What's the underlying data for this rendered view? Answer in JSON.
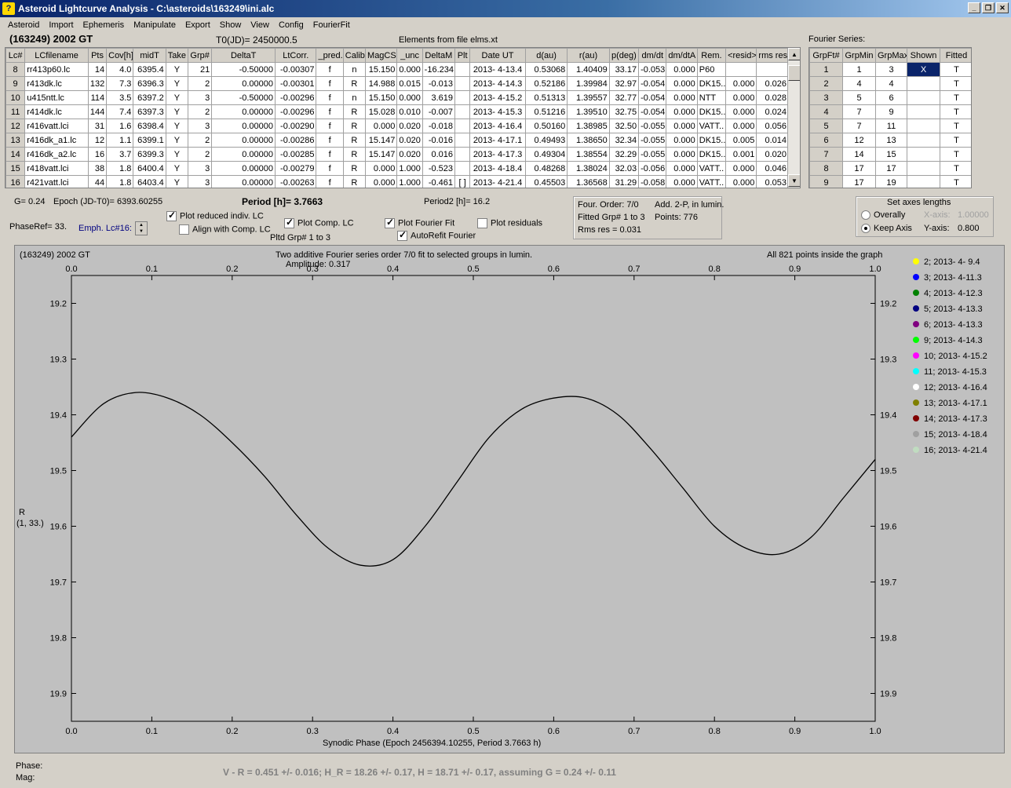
{
  "window": {
    "title": "Asteroid Lightcurve Analysis - C:\\asteroids\\163249\\ini.alc",
    "app_icon_label": "?"
  },
  "menu": [
    "Asteroid",
    "Import",
    "Ephemeris",
    "Manipulate",
    "Export",
    "Show",
    "View",
    "Config",
    "FourierFit"
  ],
  "header": {
    "asteroid": "(163249) 2002 GT",
    "t0": "T0(JD)= 2450000.5",
    "elements": "Elements from file elms.xt"
  },
  "lc_table": {
    "columns": [
      "Lc#",
      "LCfilename",
      "Pts",
      "Cov[h]",
      "midT",
      "Take",
      "Grp#",
      "DeltaT",
      "LtCorr.",
      "_pred.",
      "Calib.",
      "MagCS",
      "_unc",
      "DeltaM",
      "Plt",
      "Date UT",
      "d(au)",
      "r(au)",
      "p(deg)",
      "dm/dt",
      "dm/dtA",
      "Rem.",
      "<resid>",
      "rms res"
    ],
    "rows": [
      [
        "8",
        "rr413p60.lc",
        "14",
        "4.0",
        "6395.4",
        "Y",
        "21",
        "-0.50000",
        "-0.00307",
        "f",
        "n",
        "15.150",
        "0.000",
        "-16.234",
        "",
        "2013- 4-13.4",
        "0.53068",
        "1.40409",
        "33.17",
        "-0.053",
        "0.000",
        "P60",
        "",
        ""
      ],
      [
        "9",
        "r413dk.lc",
        "132",
        "7.3",
        "6396.3",
        "Y",
        "2",
        "0.00000",
        "-0.00301",
        "f",
        "R",
        "14.988",
        "0.015",
        "-0.013",
        "",
        "2013- 4-14.3",
        "0.52186",
        "1.39984",
        "32.97",
        "-0.054",
        "0.000",
        "DK15..",
        "0.000",
        "0.026"
      ],
      [
        "10",
        "u415ntt.lc",
        "114",
        "3.5",
        "6397.2",
        "Y",
        "3",
        "-0.50000",
        "-0.00296",
        "f",
        "n",
        "15.150",
        "0.000",
        "3.619",
        "",
        "2013- 4-15.2",
        "0.51313",
        "1.39557",
        "32.77",
        "-0.054",
        "0.000",
        "NTT",
        "0.000",
        "0.028"
      ],
      [
        "11",
        "r414dk.lc",
        "144",
        "7.4",
        "6397.3",
        "Y",
        "2",
        "0.00000",
        "-0.00296",
        "f",
        "R",
        "15.028",
        "0.010",
        "-0.007",
        "",
        "2013- 4-15.3",
        "0.51216",
        "1.39510",
        "32.75",
        "-0.054",
        "0.000",
        "DK15..",
        "0.000",
        "0.024"
      ],
      [
        "12",
        "r416vatt.lci",
        "31",
        "1.6",
        "6398.4",
        "Y",
        "3",
        "0.00000",
        "-0.00290",
        "f",
        "R",
        "0.000",
        "0.020",
        "-0.018",
        "",
        "2013- 4-16.4",
        "0.50160",
        "1.38985",
        "32.50",
        "-0.055",
        "0.000",
        "VATT..",
        "0.000",
        "0.056"
      ],
      [
        "13",
        "r416dk_a1.lc",
        "12",
        "1.1",
        "6399.1",
        "Y",
        "2",
        "0.00000",
        "-0.00286",
        "f",
        "R",
        "15.147",
        "0.020",
        "-0.016",
        "",
        "2013- 4-17.1",
        "0.49493",
        "1.38650",
        "32.34",
        "-0.055",
        "0.000",
        "DK15..",
        "0.005",
        "0.014"
      ],
      [
        "14",
        "r416dk_a2.lc",
        "16",
        "3.7",
        "6399.3",
        "Y",
        "2",
        "0.00000",
        "-0.00285",
        "f",
        "R",
        "15.147",
        "0.020",
        "0.016",
        "",
        "2013- 4-17.3",
        "0.49304",
        "1.38554",
        "32.29",
        "-0.055",
        "0.000",
        "DK15..",
        "0.001",
        "0.020"
      ],
      [
        "15",
        "r418vatt.lci",
        "38",
        "1.8",
        "6400.4",
        "Y",
        "3",
        "0.00000",
        "-0.00279",
        "f",
        "R",
        "0.000",
        "1.000",
        "-0.523",
        "",
        "2013- 4-18.4",
        "0.48268",
        "1.38024",
        "32.03",
        "-0.056",
        "0.000",
        "VATT..",
        "0.000",
        "0.046"
      ],
      [
        "16",
        "r421vatt.lci",
        "44",
        "1.8",
        "6403.4",
        "Y",
        "3",
        "0.00000",
        "-0.00263",
        "f",
        "R",
        "0.000",
        "1.000",
        "-0.461",
        "[ ]",
        "2013- 4-21.4",
        "0.45503",
        "1.36568",
        "31.29",
        "-0.058",
        "0.000",
        "VATT..",
        "0.000",
        "0.053"
      ]
    ]
  },
  "fourier_table": {
    "title": "Fourier Series:",
    "columns": [
      "GrpFt#",
      "GrpMin",
      "GrpMax",
      "Shown",
      "Fitted"
    ],
    "rows": [
      [
        "1",
        "1",
        "3",
        "X",
        "T"
      ],
      [
        "2",
        "4",
        "4",
        "",
        "T"
      ],
      [
        "3",
        "5",
        "6",
        "",
        "T"
      ],
      [
        "4",
        "7",
        "9",
        "",
        "T"
      ],
      [
        "5",
        "7",
        "11",
        "",
        "T"
      ],
      [
        "6",
        "12",
        "13",
        "",
        "T"
      ],
      [
        "7",
        "14",
        "15",
        "",
        "T"
      ],
      [
        "8",
        "17",
        "17",
        "",
        "T"
      ],
      [
        "9",
        "17",
        "19",
        "",
        "T"
      ]
    ]
  },
  "controls": {
    "g": "G= 0.24",
    "epoch": "Epoch (JD-T0)= 6393.60255",
    "period": "Period [h]= 3.7663",
    "period2": "Period2 [h]= 16.2",
    "phaseref": "PhaseRef= 33.",
    "emph": "Emph. Lc#16:",
    "plot_reduced": "Plot reduced indiv. LC",
    "align_comp": "Align with Comp. LC",
    "plot_comp": "Plot Comp. LC",
    "pltd_grp": "Pltd Grp#  1   to   3",
    "plot_fourier": "Plot Fourier Fit",
    "autorefit": "AutoRefit Fourier",
    "plot_resid": "Plot residuals",
    "four_order": "Four. Order:  7/0",
    "add2p": "Add. 2-P, in lumin.",
    "fitted_grp": "Fitted Grp# 1 to 3",
    "points": "Points: 776",
    "rms": "Rms res     = 0.031",
    "axes_title": "Set axes lengths",
    "overally": "Overally",
    "keep_axis": "Keep Axis",
    "xaxis_label": "X-axis:",
    "xaxis_val": "1.00000",
    "yaxis_label": "Y-axis:",
    "yaxis_val": "0.800"
  },
  "plot": {
    "name": "(163249) 2002 GT",
    "title": "Two additive Fourier series order 7/0 fit to selected groups in lumin.",
    "amplitude": "Amplitude: 0.317",
    "points_note": "All 821 points inside the graph",
    "xlabel": "Synodic Phase (Epoch 2456394.10255, Period 3.7663 h)",
    "ylabel": "R",
    "ylabel2": "(1, 33.)",
    "footer_phase": "Phase:",
    "footer_mag": "Mag:",
    "result": "V - R = 0.451 +/- 0.016; H_R = 18.26 +/- 0.17, H = 18.71 +/- 0.17, assuming G = 0.24 +/- 0.11"
  },
  "chart_data": {
    "type": "scatter",
    "xlim": [
      0.0,
      1.0
    ],
    "ylim": [
      19.95,
      19.15
    ],
    "x_ticks": [
      "0.0",
      "0.1",
      "0.2",
      "0.3",
      "0.4",
      "0.5",
      "0.6",
      "0.7",
      "0.8",
      "0.9",
      "1.0"
    ],
    "y_ticks": [
      "19.2",
      "19.3",
      "19.4",
      "19.5",
      "19.6",
      "19.7",
      "19.8",
      "19.9"
    ],
    "legend_position": "right",
    "series": [
      {
        "name": "2; 2013- 4- 9.4",
        "color": "#ffff00"
      },
      {
        "name": "3; 2013- 4-11.3",
        "color": "#0000ff"
      },
      {
        "name": "4; 2013- 4-12.3",
        "color": "#008000"
      },
      {
        "name": "5; 2013- 4-13.3",
        "color": "#000080"
      },
      {
        "name": "6; 2013- 4-13.3",
        "color": "#800080"
      },
      {
        "name": "9; 2013- 4-14.3",
        "color": "#00ff00"
      },
      {
        "name": "10; 2013- 4-15.2",
        "color": "#ff00ff"
      },
      {
        "name": "11; 2013- 4-15.3",
        "color": "#00ffff"
      },
      {
        "name": "12; 2013- 4-16.4",
        "color": "#ffffff"
      },
      {
        "name": "13; 2013- 4-17.1",
        "color": "#808000"
      },
      {
        "name": "14; 2013- 4-17.3",
        "color": "#800000"
      },
      {
        "name": "15; 2013- 4-18.4",
        "color": "#a0a0a0"
      },
      {
        "name": "16; 2013- 4-21.4",
        "color": "#c0dcc0"
      }
    ],
    "fit_curve": {
      "x": [
        0.0,
        0.04,
        0.08,
        0.12,
        0.16,
        0.2,
        0.24,
        0.28,
        0.32,
        0.36,
        0.4,
        0.44,
        0.48,
        0.52,
        0.56,
        0.6,
        0.64,
        0.68,
        0.72,
        0.76,
        0.8,
        0.84,
        0.88,
        0.92,
        0.96,
        1.0
      ],
      "y": [
        19.44,
        19.38,
        19.36,
        19.37,
        19.4,
        19.45,
        19.51,
        19.58,
        19.64,
        19.67,
        19.66,
        19.6,
        19.52,
        19.44,
        19.39,
        19.37,
        19.37,
        19.4,
        19.46,
        19.53,
        19.6,
        19.64,
        19.65,
        19.62,
        19.55,
        19.48
      ]
    }
  }
}
